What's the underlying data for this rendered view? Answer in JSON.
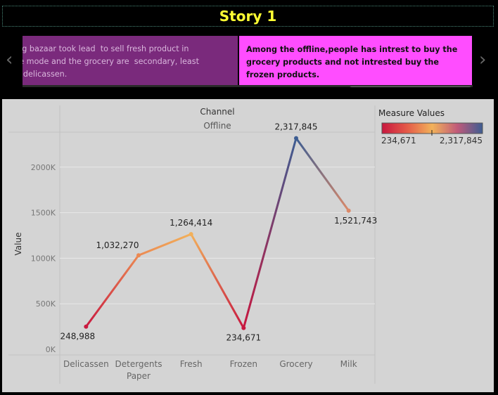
{
  "title": "Story 1",
  "story_points": [
    {
      "text": "e Big bazaar took lead  to sell fresh product in\nfline mode and the grocery are  secondary, least\ne is delicassen."
    },
    {
      "text": "Among the  offline,people has intrest to buy the grocery products and not intrested buy the frozen products."
    }
  ],
  "nav": {
    "prev_icon": "‹",
    "next_icon": "›"
  },
  "chart_data": {
    "type": "line",
    "header_label": "Channel",
    "header_value": "Offline",
    "ylabel": "Value",
    "categories": [
      "Delicassen",
      "Detergents Paper",
      "Fresh",
      "Frozen",
      "Grocery",
      "Milk"
    ],
    "category_lines": [
      [
        "Delicassen"
      ],
      [
        "Detergents",
        "Paper"
      ],
      [
        "Fresh"
      ],
      [
        "Frozen"
      ],
      [
        "Grocery"
      ],
      [
        "Milk"
      ]
    ],
    "values": [
      248988,
      1032270,
      1264414,
      234671,
      2317845,
      1521743
    ],
    "value_labels": [
      "248,988",
      "1,032,270",
      "1,264,414",
      "234,671",
      "2,317,845",
      "1,521,743"
    ],
    "ylim": [
      0,
      2400000
    ],
    "yticks": [
      0,
      500000,
      1000000,
      1500000,
      2000000
    ],
    "ytick_labels": [
      "0K",
      "500K",
      "1000K",
      "1500K",
      "2000K"
    ],
    "grid": true,
    "legend": {
      "title": "Measure Values",
      "min_label": "234,671",
      "max_label": "2,317,845",
      "placement": "top-right",
      "colors": [
        "#c8173f",
        "#e45a48",
        "#f2b25a",
        "#c05a7a",
        "#3d5d92"
      ]
    }
  }
}
